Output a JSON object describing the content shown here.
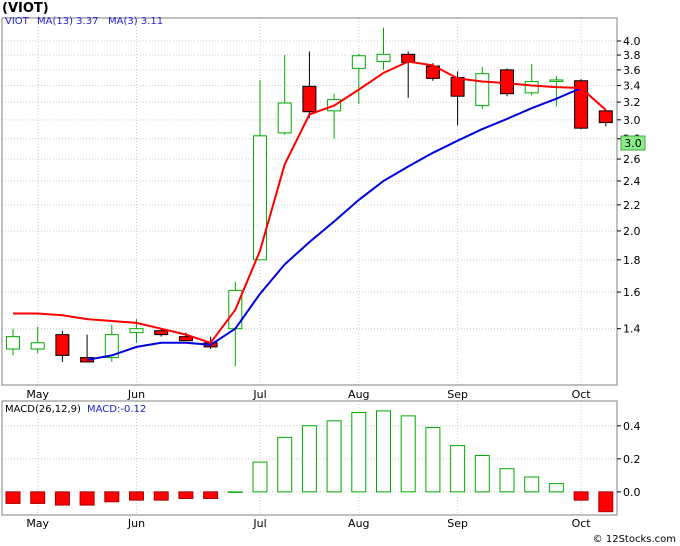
{
  "page": {
    "title": "(VIOT)",
    "watermark": "© 12Stocks.com",
    "colors": {
      "bull": "#00aa00",
      "bear": "#ff0000",
      "ma13": "#0000dd",
      "ma3": "#ff0000",
      "panel_border": "#808080",
      "grid": "#cccccc",
      "price_badge_bg": "#88ee88",
      "legend_text": "#2222cc"
    }
  },
  "legend": {
    "ticker": "VIOT",
    "ma13": "MA(13)  3.37",
    "ma3": "MA(3)  3.11",
    "price_badge": "3.0"
  },
  "macd_legend": {
    "params": "MACD(26,12,9)",
    "value": "MACD:-0.12"
  },
  "chart_data": [
    {
      "type": "candlestick",
      "title": "(VIOT)",
      "period": "weekly",
      "y_scale": "log",
      "ylim": [
        1.14,
        4.35
      ],
      "y_ticks": [
        {
          "v": 4.0,
          "label": "4.0"
        },
        {
          "v": 3.8,
          "label": "3.8"
        },
        {
          "v": 3.6,
          "label": "3.6"
        },
        {
          "v": 3.4,
          "label": "3.4"
        },
        {
          "v": 3.2,
          "label": "3.2"
        },
        {
          "v": 3.0,
          "label": "3.0"
        },
        {
          "v": 2.8,
          "label": "2.8"
        },
        {
          "v": 2.6,
          "label": "2.6"
        },
        {
          "v": 2.4,
          "label": "2.4"
        },
        {
          "v": 2.2,
          "label": "2.2"
        },
        {
          "v": 2.0,
          "label": "2.0"
        },
        {
          "v": 1.8,
          "label": "1.8"
        },
        {
          "v": 1.6,
          "label": "1.6"
        },
        {
          "v": 1.4,
          "label": "1.4"
        }
      ],
      "x_labels": [
        {
          "label": "May",
          "index": 1
        },
        {
          "label": "Jun",
          "index": 5
        },
        {
          "label": "Jul",
          "index": 10
        },
        {
          "label": "Aug",
          "index": 14
        },
        {
          "label": "Sep",
          "index": 18
        },
        {
          "label": "Oct",
          "index": 23
        }
      ],
      "candles": [
        {
          "o": 1.3,
          "h": 1.4,
          "l": 1.27,
          "c": 1.36
        },
        {
          "o": 1.3,
          "h": 1.41,
          "l": 1.28,
          "c": 1.33
        },
        {
          "o": 1.37,
          "h": 1.39,
          "l": 1.24,
          "c": 1.27
        },
        {
          "o": 1.26,
          "h": 1.37,
          "l": 1.24,
          "c": 1.24
        },
        {
          "o": 1.26,
          "h": 1.42,
          "l": 1.24,
          "c": 1.37
        },
        {
          "o": 1.38,
          "h": 1.45,
          "l": 1.33,
          "c": 1.4
        },
        {
          "o": 1.39,
          "h": 1.4,
          "l": 1.36,
          "c": 1.37
        },
        {
          "o": 1.36,
          "h": 1.38,
          "l": 1.34,
          "c": 1.34
        },
        {
          "o": 1.33,
          "h": 1.36,
          "l": 1.3,
          "c": 1.31
        },
        {
          "o": 1.4,
          "h": 1.66,
          "l": 1.22,
          "c": 1.61
        },
        {
          "o": 1.8,
          "h": 3.47,
          "l": 1.8,
          "c": 2.83
        },
        {
          "o": 2.86,
          "h": 3.8,
          "l": 2.84,
          "c": 3.19
        },
        {
          "o": 3.39,
          "h": 3.85,
          "l": 3.02,
          "c": 3.09
        },
        {
          "o": 3.1,
          "h": 3.3,
          "l": 2.8,
          "c": 3.23
        },
        {
          "o": 3.62,
          "h": 3.82,
          "l": 3.18,
          "c": 3.79
        },
        {
          "o": 3.71,
          "h": 4.2,
          "l": 3.6,
          "c": 3.81
        },
        {
          "o": 3.81,
          "h": 3.85,
          "l": 3.25,
          "c": 3.7
        },
        {
          "o": 3.65,
          "h": 3.69,
          "l": 3.46,
          "c": 3.49
        },
        {
          "o": 3.5,
          "h": 3.58,
          "l": 2.94,
          "c": 3.27
        },
        {
          "o": 3.16,
          "h": 3.64,
          "l": 3.12,
          "c": 3.55
        },
        {
          "o": 3.6,
          "h": 3.62,
          "l": 3.27,
          "c": 3.3
        },
        {
          "o": 3.31,
          "h": 3.68,
          "l": 3.28,
          "c": 3.45
        },
        {
          "o": 3.47,
          "h": 3.52,
          "l": 3.15,
          "c": 3.47
        },
        {
          "o": 3.46,
          "h": 3.48,
          "l": 2.9,
          "c": 2.91
        },
        {
          "o": 3.1,
          "h": 3.11,
          "l": 2.93,
          "c": 2.97
        }
      ],
      "series": [
        {
          "name": "MA(13)",
          "values": [
            null,
            null,
            null,
            1.25,
            1.27,
            1.31,
            1.33,
            1.33,
            1.32,
            1.4,
            1.59,
            1.77,
            1.92,
            2.07,
            2.24,
            2.4,
            2.53,
            2.66,
            2.78,
            2.9,
            3.01,
            3.13,
            3.24,
            3.37,
            null
          ]
        },
        {
          "name": "MA(3)",
          "values": [
            1.48,
            1.48,
            1.47,
            1.45,
            1.44,
            1.43,
            1.4,
            1.37,
            1.33,
            1.5,
            1.86,
            2.55,
            3.06,
            3.16,
            3.35,
            3.56,
            3.71,
            3.66,
            3.49,
            3.45,
            3.43,
            3.4,
            3.38,
            3.37,
            3.11
          ]
        }
      ]
    },
    {
      "type": "bar",
      "title": "MACD(26,12,9)",
      "ylim": [
        -0.14,
        0.55
      ],
      "y_ticks": [
        {
          "v": 0.4,
          "label": "0.4"
        },
        {
          "v": 0.2,
          "label": "0.2"
        },
        {
          "v": 0.0,
          "label": "0.0"
        }
      ],
      "x_labels": [
        {
          "label": "May",
          "index": 1
        },
        {
          "label": "Jun",
          "index": 5
        },
        {
          "label": "Jul",
          "index": 10
        },
        {
          "label": "Aug",
          "index": 14
        },
        {
          "label": "Sep",
          "index": 18
        },
        {
          "label": "Oct",
          "index": 23
        }
      ],
      "values": [
        -0.07,
        -0.07,
        -0.08,
        -0.08,
        -0.06,
        -0.05,
        -0.05,
        -0.04,
        -0.04,
        0.0,
        0.18,
        0.33,
        0.4,
        0.43,
        0.48,
        0.49,
        0.46,
        0.39,
        0.28,
        0.22,
        0.14,
        0.09,
        0.05,
        -0.05,
        -0.12
      ]
    }
  ]
}
